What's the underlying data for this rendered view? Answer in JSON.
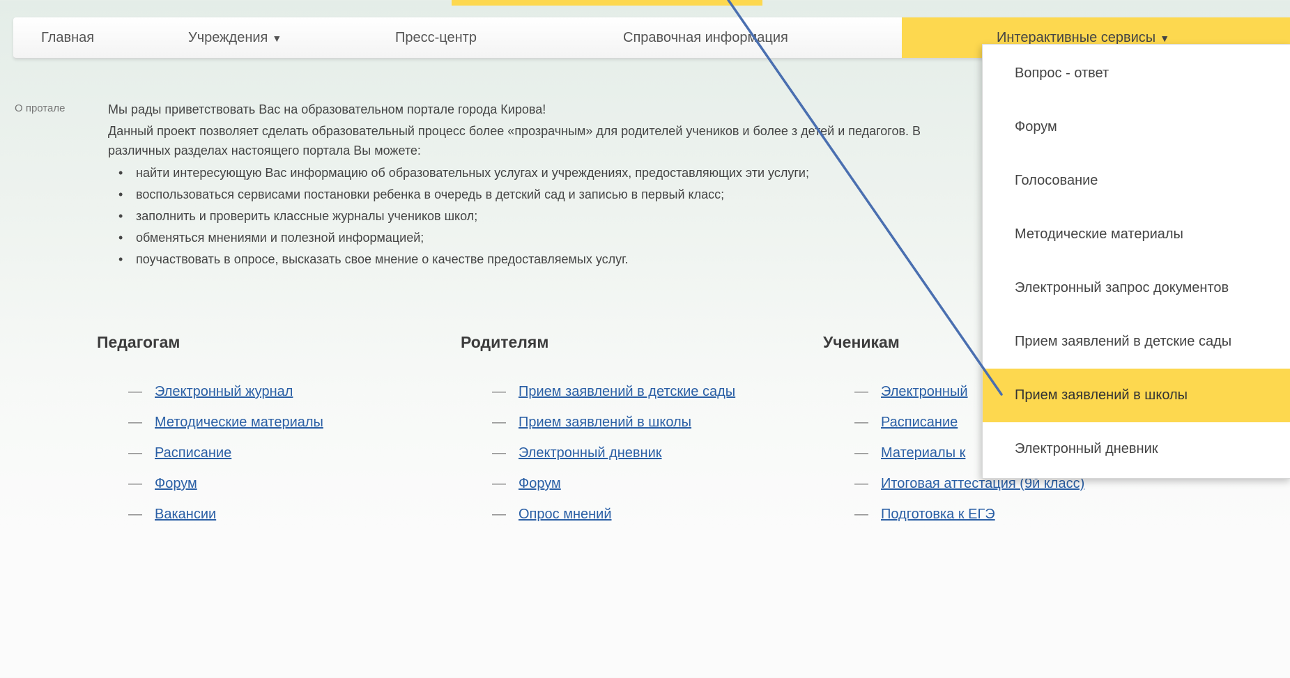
{
  "nav": {
    "items": [
      {
        "label": "Главная"
      },
      {
        "label": "Учреждения",
        "arrow": "▼"
      },
      {
        "label": "Пресс-центр"
      },
      {
        "label": "Справочная информация"
      },
      {
        "label": "Интерактивные сервисы",
        "arrow": "▼"
      }
    ]
  },
  "about": {
    "label": "О протале",
    "greeting": "Мы рады приветствовать Вас на образовательном портале города Кирова!",
    "description": "Данный проект позволяет сделать образовательный процесс более «прозрачным» для родителей учеников и более з детей и педагогов. В различных разделах настоящего портала Вы можете:",
    "bullets": [
      "найти интересующую Вас информацию об образовательных услугах и учреждениях, предоставляющих эти услуги;",
      "воспользоваться сервисами постановки ребенка в очередь в детский сад и записью в первый класс;",
      "заполнить и проверить классные журналы учеников школ;",
      "обменяться мнениями и полезной информацией;",
      "поучаствовать в опросе, высказать свое мнение о качестве предоставляемых услуг."
    ]
  },
  "columns": [
    {
      "title": "Педагогам",
      "links": [
        "Электронный журнал",
        "Методические материалы",
        "Расписание",
        "Форум",
        "Вакансии"
      ]
    },
    {
      "title": "Родителям",
      "links": [
        "Прием заявлений в детские сады",
        "Прием заявлений в школы",
        "Электронный дневник",
        "Форум",
        "Опрос мнений"
      ]
    },
    {
      "title": "Ученикам",
      "links": [
        "Электронный",
        "Расписание",
        "Материалы к",
        "Итоговая аттестация (9й класс)",
        "Подготовка к ЕГЭ"
      ]
    }
  ],
  "dropdown": {
    "items": [
      "Вопрос - ответ",
      "Форум",
      "Голосование",
      "Методические материалы",
      "Электронный запрос документов",
      "Прием заявлений в детские сады",
      "Прием заявлений в школы",
      "Электронный дневник"
    ],
    "highlighted_index": 6
  },
  "colors": {
    "accent": "#fdd84f",
    "link": "#2a5fa5",
    "pointer": "#4a6fb0"
  },
  "icons": {
    "dash": "—"
  }
}
